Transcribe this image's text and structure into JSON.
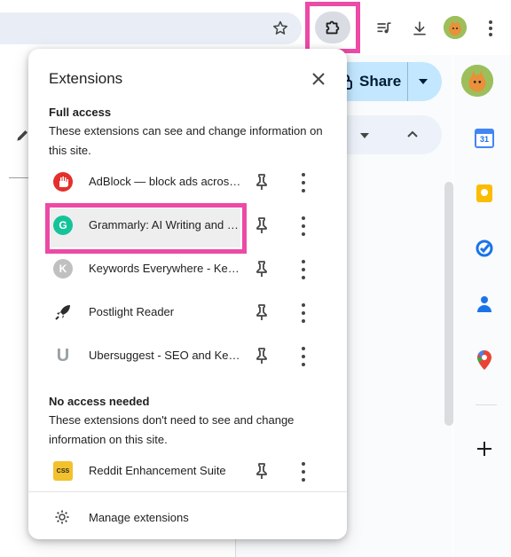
{
  "toolbar": {
    "icons": [
      "bookmark-star-icon",
      "extensions-puzzle-icon",
      "media-controls-icon",
      "download-icon",
      "profile-avatar",
      "chrome-menu-icon"
    ]
  },
  "docs": {
    "share_label": "Share"
  },
  "popup": {
    "title": "Extensions",
    "full_access": {
      "heading": "Full access",
      "description": "These extensions can see and change information on this site.",
      "items": [
        {
          "name": "AdBlock — block ads across the web",
          "logo_color": "#e4302c"
        },
        {
          "name": "Grammarly: AI Writing and Grammar Checker",
          "logo_color": "#15c39a"
        },
        {
          "name": "Keywords Everywhere - Keyword Tool",
          "logo_color": "#c0c0c0"
        },
        {
          "name": "Postlight Reader",
          "logo_color": "#2d2d2d"
        },
        {
          "name": "Ubersuggest - SEO and Keyword Discovery",
          "logo_color": "#9aa0a6"
        }
      ]
    },
    "no_access": {
      "heading": "No access needed",
      "description": "These extensions don't need to see and change information on this site.",
      "items": [
        {
          "name": "Reddit Enhancement Suite",
          "logo_color": "#f2c12e",
          "logo_text": "CSS"
        }
      ]
    },
    "manage_label": "Manage extensions"
  },
  "side_panel": {
    "icons": [
      "calendar-icon",
      "keep-icon",
      "tasks-icon",
      "contacts-icon",
      "maps-icon",
      "add-icon"
    ],
    "calendar_day": "31"
  },
  "colors": {
    "highlight": "#ec4aa6",
    "share_bg": "#c2e7ff"
  }
}
